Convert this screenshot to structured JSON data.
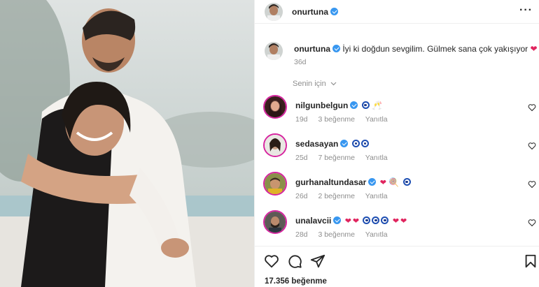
{
  "post": {
    "username": "onurtuna",
    "more_icon": "more-horizontal-icon",
    "caption": {
      "username": "onurtuna",
      "text": "İyi ki doğdun sevgilim. Gülmek sana çok yakışıyor",
      "emoji": "❤",
      "age": "36d"
    },
    "filter_label": "Senin için"
  },
  "comments": [
    {
      "username": "nilgunbelgun",
      "emoji_text": "🥂",
      "eyes": 1,
      "hearts": 0,
      "age": "19d",
      "likes": "3 beğenme",
      "reply": "Yanıtla"
    },
    {
      "username": "sedasayan",
      "emoji_text": "",
      "eyes": 2,
      "hearts": 0,
      "age": "25d",
      "likes": "7 beğenme",
      "reply": "Yanıtla"
    },
    {
      "username": "gurhanaltundasar",
      "emoji_text": "🍭",
      "eyes": 1,
      "hearts": 1,
      "age": "26d",
      "likes": "2 beğenme",
      "reply": "Yanıtla"
    },
    {
      "username": "unalavcii",
      "emoji_text": "",
      "eyes": 3,
      "hearts": 4,
      "age": "28d",
      "likes": "3 beğenme",
      "reply": "Yanıtla"
    }
  ],
  "actions": {
    "like_icon": "heart-outline-icon",
    "comment_icon": "comment-bubble-icon",
    "share_icon": "paper-plane-icon",
    "save_icon": "bookmark-icon",
    "likes_count": "17.356 beğenme"
  },
  "colors": {
    "verified": "#3897f0",
    "heart": "#e0245e",
    "story_ring": "#d6249f",
    "muted": "#8e8e8e"
  }
}
